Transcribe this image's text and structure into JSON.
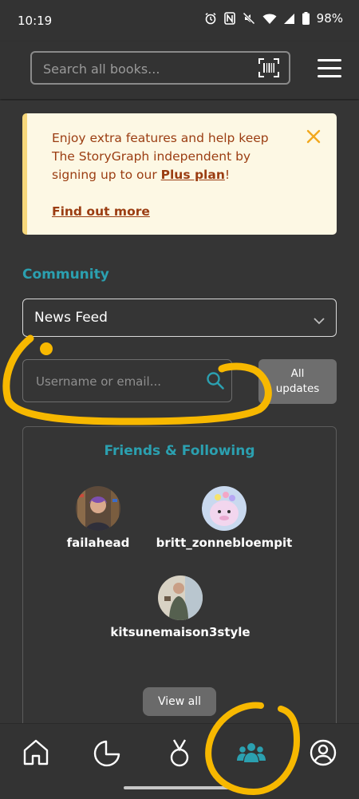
{
  "status_bar": {
    "time": "10:19",
    "battery": "98%",
    "icons": [
      "alarm-icon",
      "nfc-icon",
      "mute-icon",
      "wifi-icon",
      "signal-icon",
      "battery-icon"
    ]
  },
  "header": {
    "search_placeholder": "Search all books...",
    "barcode_icon": "barcode-scan-icon",
    "menu_icon": "hamburger-menu-icon"
  },
  "plus_banner": {
    "text": "Enjoy extra features and help keep The StoryGraph independent by signing up to our ",
    "link_text": "Plus plan",
    "trailing": "!",
    "find_out_more": "Find out more",
    "close_icon": "close-icon"
  },
  "community": {
    "title": "Community",
    "selected_feed": "News Feed",
    "user_search_placeholder": "Username or email...",
    "all_updates_line1": "All",
    "all_updates_line2": "updates"
  },
  "friends": {
    "title": "Friends & Following",
    "people": [
      {
        "username": "failahead"
      },
      {
        "username": "britt_zonnebloempit"
      },
      {
        "username": "kitsunemaison3style"
      }
    ],
    "view_all": "View all"
  },
  "bottom_nav": {
    "items": [
      "home-icon",
      "stats-pie-icon",
      "challenges-medal-icon",
      "community-icon",
      "profile-icon"
    ],
    "active": "community-icon"
  },
  "colors": {
    "background": "#333333",
    "accent_teal": "#2ba0b0",
    "banner_bg": "#fdf8e4",
    "banner_text": "#9b3d12",
    "annotation_yellow": "#f7b800"
  }
}
